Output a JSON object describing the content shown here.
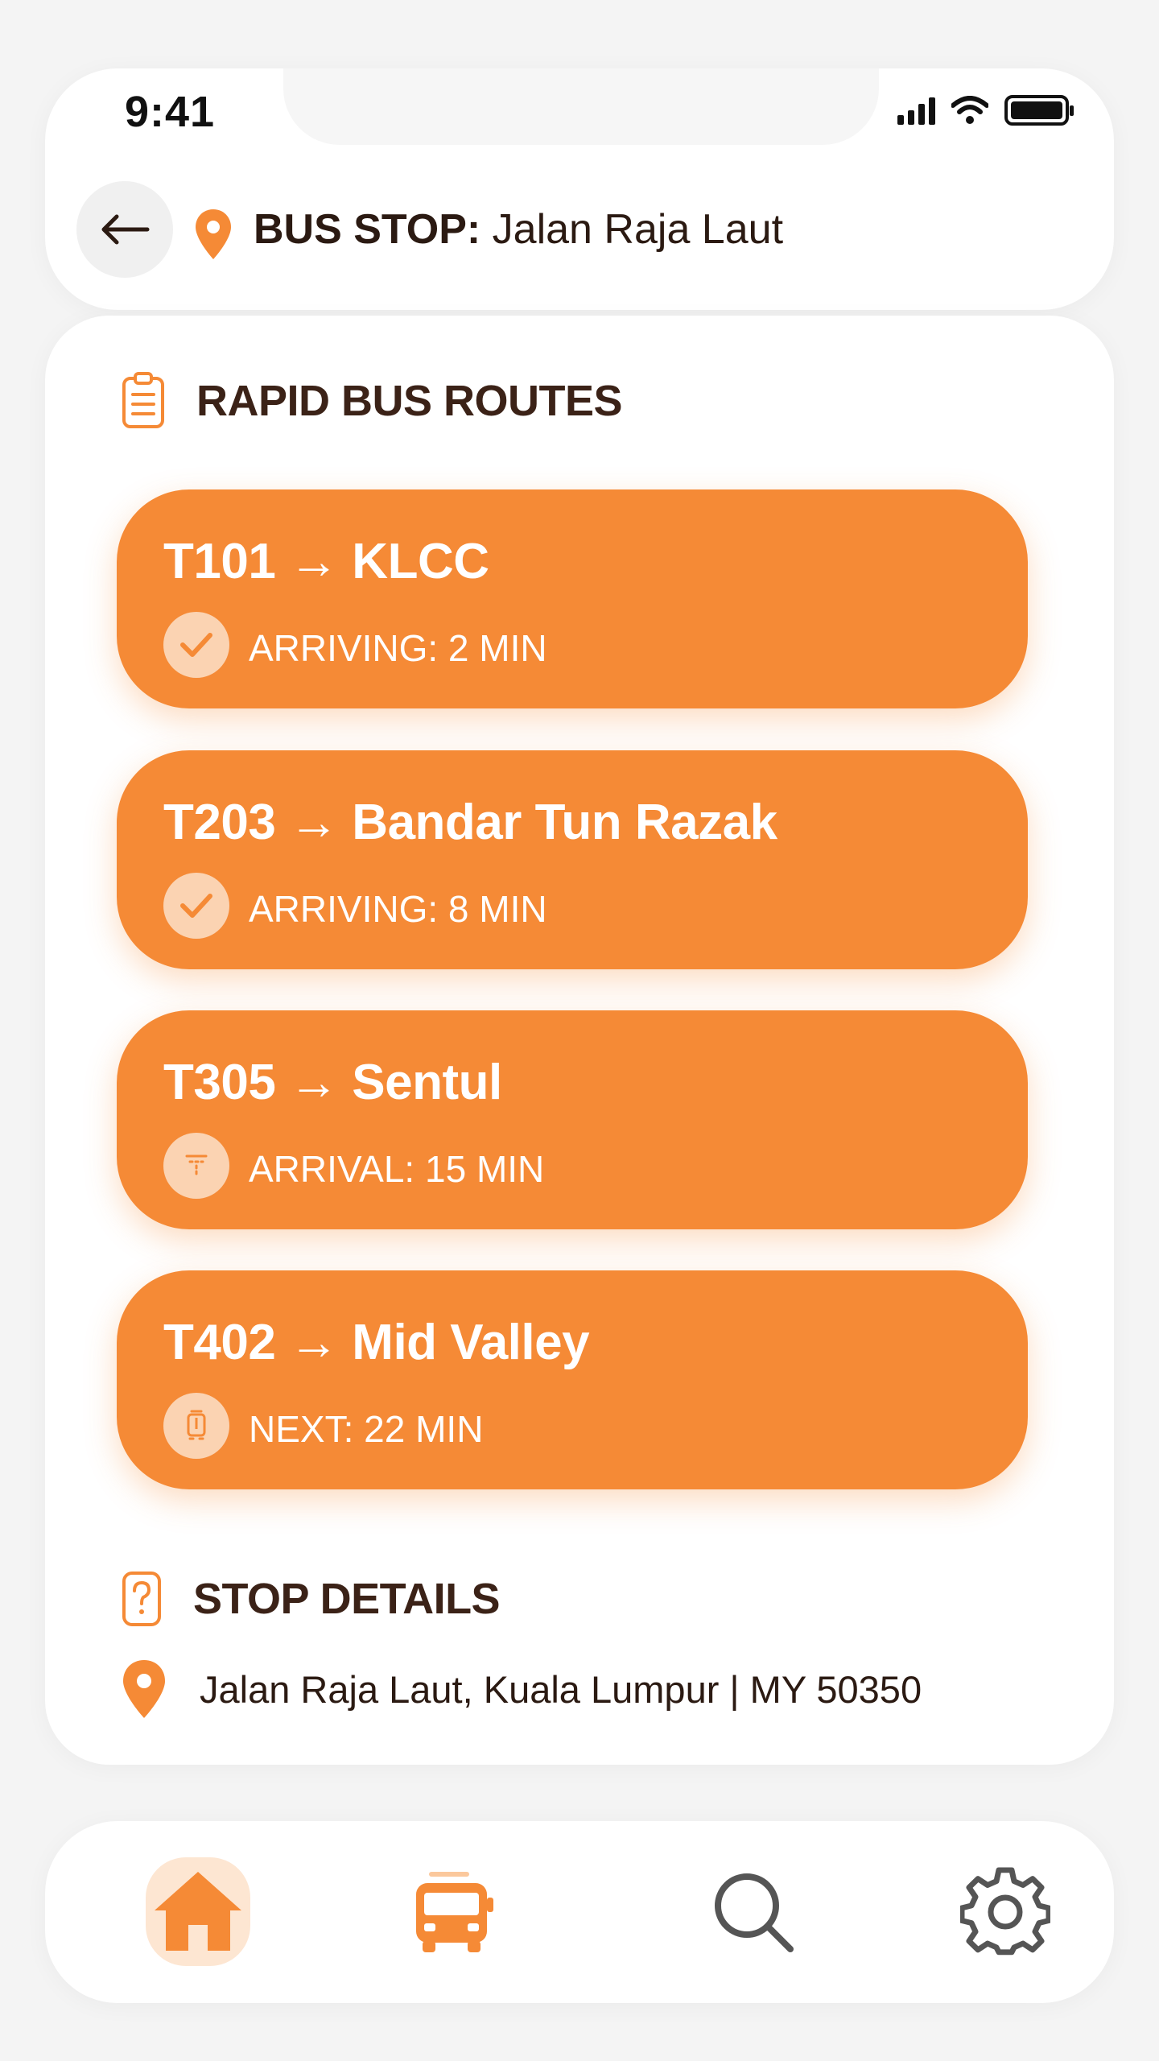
{
  "status_bar": {
    "time": "9:41"
  },
  "header": {
    "title_prefix": "BUS STOP:",
    "title_stop": "Jalan Raja Laut"
  },
  "routes_section": {
    "title": "RAPID BUS ROUTES"
  },
  "routes": [
    {
      "code": "T101",
      "arrow": "→",
      "destination": "KLCC",
      "status": "ARRIVING: 2 MIN",
      "status_icon": "check-icon"
    },
    {
      "code": "T203",
      "arrow": "→",
      "destination": "Bandar Tun Razak",
      "status": "ARRIVING: 8 MIN",
      "status_icon": "check-icon"
    },
    {
      "code": "T305",
      "arrow": "→",
      "destination": "Sentul",
      "status": "ARRIVAL: 15 MIN",
      "status_icon": "bus-front-icon"
    },
    {
      "code": "T402",
      "arrow": "→",
      "destination": "Mid Valley",
      "status": "NEXT: 22 MIN",
      "status_icon": "bus-icon"
    }
  ],
  "details_section": {
    "title": "STOP DETAILS",
    "address": "Jalan Raja Laut, Kuala Lumpur | MY 50350"
  },
  "nav": {
    "items": [
      {
        "name": "home",
        "icon": "home-icon",
        "active": true
      },
      {
        "name": "bus",
        "icon": "bus-icon",
        "active": false
      },
      {
        "name": "search",
        "icon": "search-icon",
        "active": false
      },
      {
        "name": "settings",
        "icon": "gear-icon",
        "active": false
      }
    ]
  },
  "colors": {
    "accent": "#f58a36",
    "text_dark": "#3b2217",
    "background": "#f4f4f4",
    "card": "#ffffff"
  }
}
